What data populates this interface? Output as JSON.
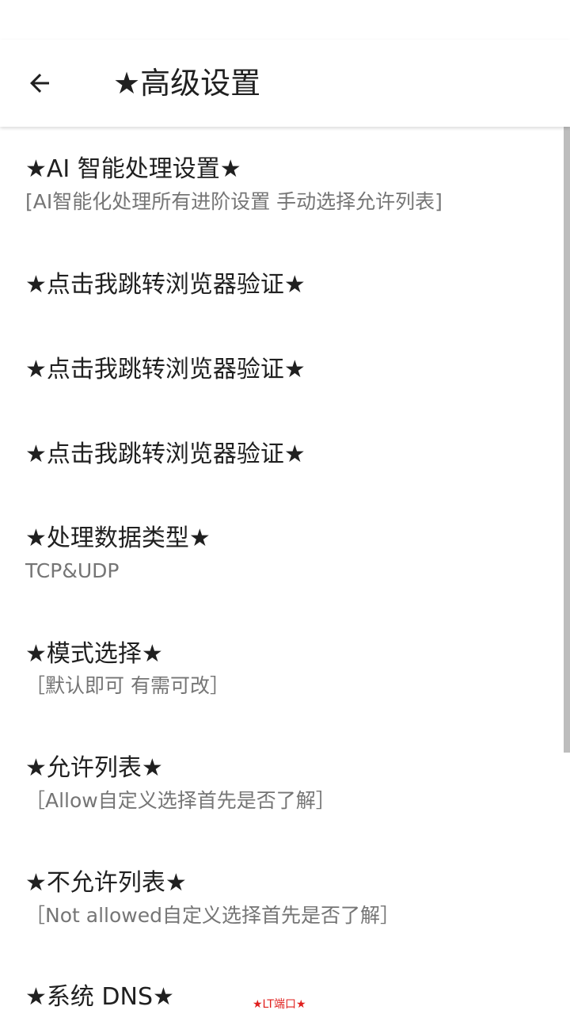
{
  "header": {
    "title": "★高级设置"
  },
  "preferences": [
    {
      "title": "★AI 智能处理设置★",
      "summary": "[AI智能化处理所有进阶设置 手动选择允许列表]"
    },
    {
      "title": "★点击我跳转浏览器验证★"
    },
    {
      "title": "★点击我跳转浏览器验证★"
    },
    {
      "title": "★点击我跳转浏览器验证★"
    },
    {
      "title": "★处理数据类型★",
      "summary": "TCP&UDP"
    },
    {
      "title": "★模式选择★",
      "summary": "［默认即可 有需可改］"
    },
    {
      "title": "★允许列表★",
      "summary": "［Allow自定义选择首先是否了解］"
    },
    {
      "title": "★不允许列表★",
      "summary": "［Not allowed自定义选择首先是否了解］"
    },
    {
      "title": "★系统 DNS★"
    }
  ],
  "watermark": "★LT端口★",
  "icons": {
    "back": "arrow-left-icon"
  },
  "colors": {
    "title_text": "#202020",
    "summary_text": "#757575",
    "watermark": "#e0201e"
  }
}
